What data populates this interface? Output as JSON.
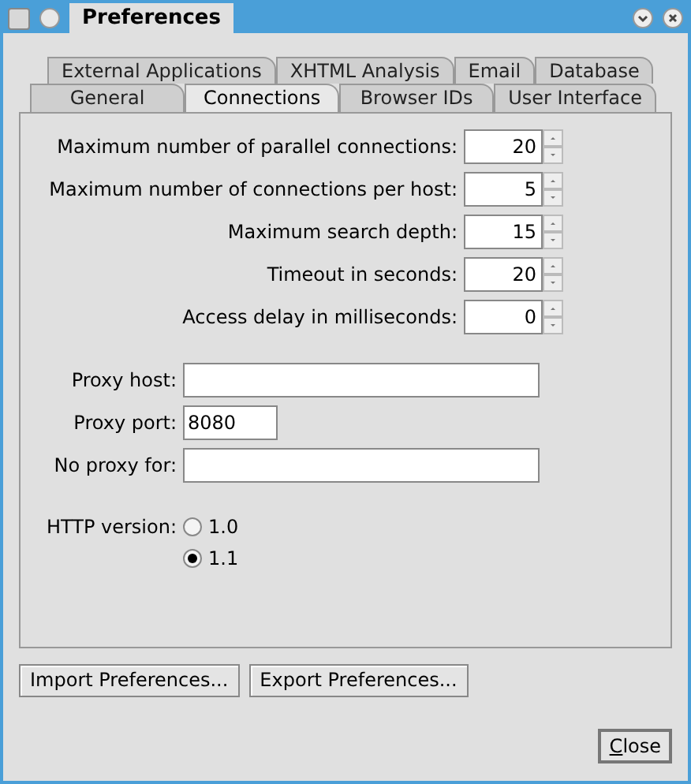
{
  "window": {
    "title": "Preferences"
  },
  "tab_rows": [
    [
      {
        "label": "External Applications",
        "selected": false
      },
      {
        "label": "XHTML Analysis",
        "selected": false
      },
      {
        "label": "Email",
        "selected": false
      },
      {
        "label": "Database",
        "selected": false
      }
    ],
    [
      {
        "label": "General",
        "selected": false
      },
      {
        "label": "Connections",
        "selected": true
      },
      {
        "label": "Browser IDs",
        "selected": false
      },
      {
        "label": "User Interface",
        "selected": false
      }
    ]
  ],
  "spinners": [
    {
      "label": "Maximum number of parallel connections:",
      "value": "20"
    },
    {
      "label": "Maximum number of connections per host:",
      "value": "5"
    },
    {
      "label": "Maximum search depth:",
      "value": "15"
    },
    {
      "label": "Timeout in seconds:",
      "value": "20"
    },
    {
      "label": "Access delay in milliseconds:",
      "value": "0"
    }
  ],
  "proxy_fields": [
    {
      "label": "Proxy host:",
      "kind": "wide"
    },
    {
      "label": "Proxy port:",
      "value": "8080",
      "kind": "narrow"
    },
    {
      "label": "No proxy for:",
      "kind": "wide"
    }
  ],
  "http_version": {
    "label": "HTTP version:",
    "options": [
      {
        "label": "1.0",
        "selected": false
      },
      {
        "label": "1.1",
        "selected": true
      }
    ]
  },
  "buttons": [
    "Import Preferences...",
    "Export Preferences..."
  ],
  "close_button": {
    "label": "Close",
    "mnemonic_underlined": true
  }
}
